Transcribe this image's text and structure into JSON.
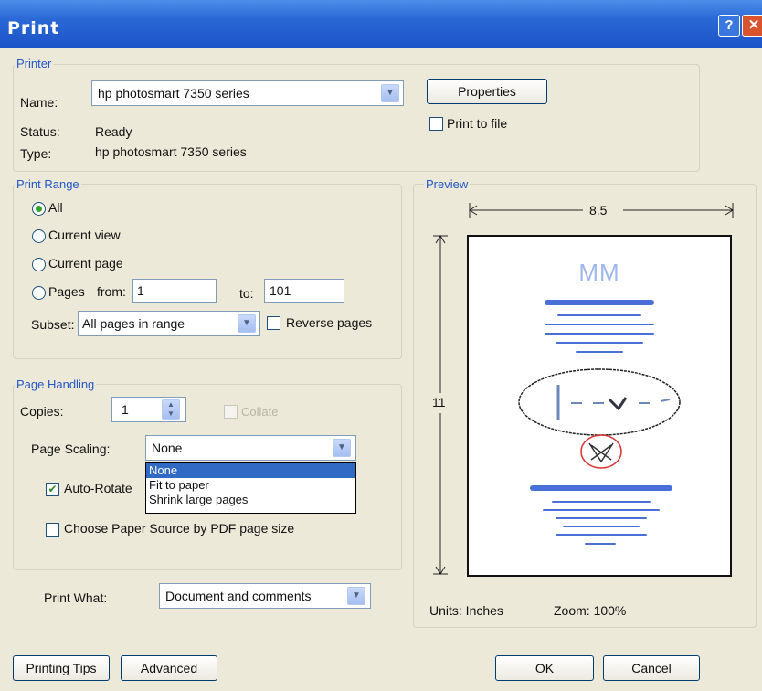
{
  "window": {
    "title": "Print",
    "help_glyph": "?",
    "close_glyph": "✕"
  },
  "printer": {
    "legend": "Printer",
    "name_label": "Name:",
    "name_value": "hp photosmart 7350 series",
    "status_label": "Status:",
    "status_value": "Ready",
    "type_label": "Type:",
    "type_value": "hp photosmart 7350 series",
    "properties_button": "Properties",
    "print_to_file_label": "Print to file",
    "print_to_file_checked": false
  },
  "print_range": {
    "legend": "Print Range",
    "options": [
      "All",
      "Current view",
      "Current page",
      "Pages"
    ],
    "selected": "All",
    "from_label": "from:",
    "from_value": "1",
    "to_label": "to:",
    "to_value": "101",
    "subset_label": "Subset:",
    "subset_value": "All pages in range",
    "reverse_label": "Reverse pages"
  },
  "page_handling": {
    "legend": "Page Handling",
    "copies_label": "Copies:",
    "copies_value": "1",
    "collate_label": "Collate",
    "scaling_label": "Page Scaling:",
    "scaling_value": "None",
    "scaling_options": [
      "None",
      "Fit to paper",
      "Shrink large pages"
    ],
    "scaling_highlighted": "None",
    "auto_rotate_label": "Auto-Rotate",
    "auto_rotate_checked": true,
    "paper_source_label": "Choose Paper Source by PDF page size",
    "paper_source_checked": false
  },
  "print_what": {
    "label": "Print What:",
    "value": "Document and comments"
  },
  "preview": {
    "legend": "Preview",
    "width_value": "8.5",
    "height_value": "11",
    "units_text": "Units: Inches",
    "zoom_text": "Zoom: 100%",
    "monogram": "MM"
  },
  "footer": {
    "tips_button": "Printing Tips",
    "advanced_button": "Advanced",
    "ok_button": "OK",
    "cancel_button": "Cancel"
  },
  "colors": {
    "title_bar": "#2a68d6",
    "legend": "#2457c9",
    "selection": "#316ac5",
    "preview_ink": "#4a6fd8"
  }
}
